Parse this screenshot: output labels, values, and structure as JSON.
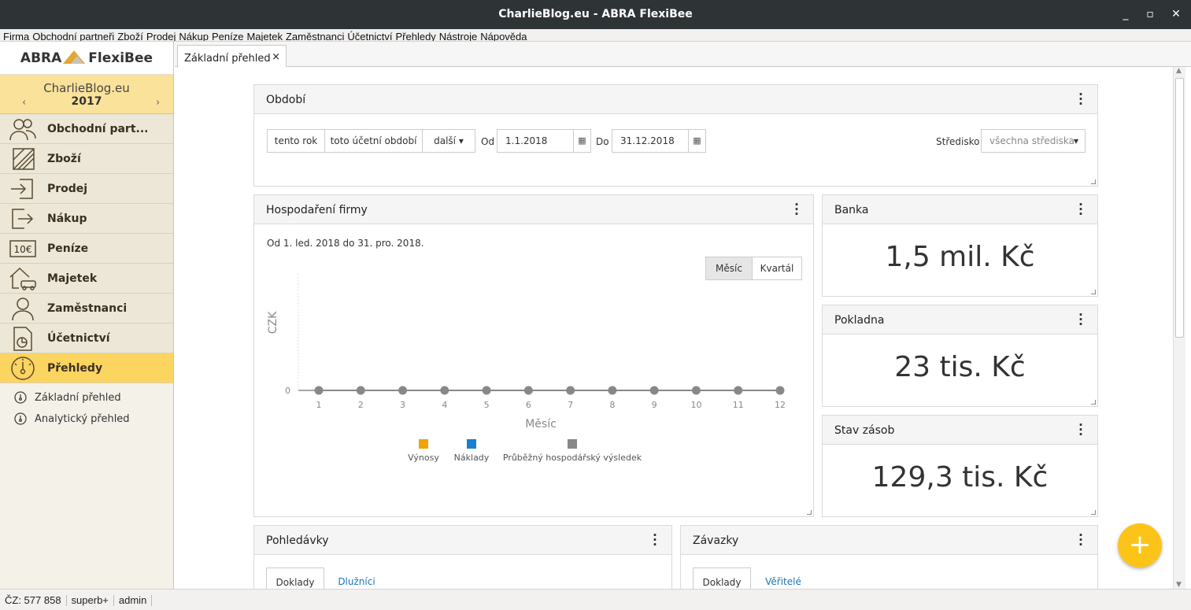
{
  "window": {
    "title": "CharlieBlog.eu - ABRA FlexiBee"
  },
  "menu": [
    "Firma",
    "Obchodní partneři",
    "Zboží",
    "Prodej",
    "Nákup",
    "Peníze",
    "Majetek",
    "Zaměstnanci",
    "Účetnictví",
    "Přehledy",
    "Nástroje",
    "Nápověda"
  ],
  "sidebar": {
    "logo_left": "ABRA",
    "logo_right": "FlexiBee",
    "company": "CharlieBlog.eu",
    "year": "2017",
    "prev": "‹",
    "next": "›",
    "items": [
      {
        "label": "Obchodní part..."
      },
      {
        "label": "Zboží"
      },
      {
        "label": "Prodej"
      },
      {
        "label": "Nákup"
      },
      {
        "label": "Peníze"
      },
      {
        "label": "Majetek"
      },
      {
        "label": "Zaměstnanci"
      },
      {
        "label": "Účetnictví"
      },
      {
        "label": "Přehledy"
      }
    ],
    "money_icon_text": "10€",
    "subitems": [
      {
        "label": "Základní přehled"
      },
      {
        "label": "Analytický přehled"
      }
    ]
  },
  "tab": {
    "label": "Základní přehled",
    "close": "×"
  },
  "period": {
    "title": "Období",
    "btn_this_year": "tento rok",
    "btn_this_period": "toto účetní období",
    "btn_more": "další",
    "from_label": "Od",
    "from_value": "1.1.2018",
    "to_label": "Do",
    "to_value": "31.12.2018",
    "center_label": "Středisko",
    "center_value": "všechna střediska"
  },
  "hosp": {
    "title": "Hospodaření firmy",
    "range": "Od 1. led. 2018 do 31. pro. 2018.",
    "btn_month": "Měsíc",
    "btn_quarter": "Kvartál"
  },
  "chart_data": {
    "type": "line",
    "categories": [
      "1",
      "2",
      "3",
      "4",
      "5",
      "6",
      "7",
      "8",
      "9",
      "10",
      "11",
      "12"
    ],
    "series": [
      {
        "name": "Výnosy",
        "color": "#f0a30a",
        "values": []
      },
      {
        "name": "Náklady",
        "color": "#1a7fcf",
        "values": []
      },
      {
        "name": "Průběžný hospodářský výsledek",
        "color": "#888888",
        "values": [
          0,
          0,
          0,
          0,
          0,
          0,
          0,
          0,
          0,
          0,
          0,
          0
        ]
      }
    ],
    "xlabel": "Měsíc",
    "ylabel": "CZK",
    "yticks": [
      "0"
    ]
  },
  "banka": {
    "title": "Banka",
    "value": "1,5 mil. Kč"
  },
  "pokladna": {
    "title": "Pokladna",
    "value": "23 tis. Kč"
  },
  "zasoby": {
    "title": "Stav zásob",
    "value": "129,3 tis. Kč"
  },
  "pohledavky": {
    "title": "Pohledávky",
    "tab1": "Doklady",
    "tab2": "Dlužníci"
  },
  "zavazky": {
    "title": "Závazky",
    "tab1": "Doklady",
    "tab2": "Věřitelé"
  },
  "fab": "+",
  "status": [
    "ČZ: 577 858",
    "superb+",
    "admin"
  ]
}
